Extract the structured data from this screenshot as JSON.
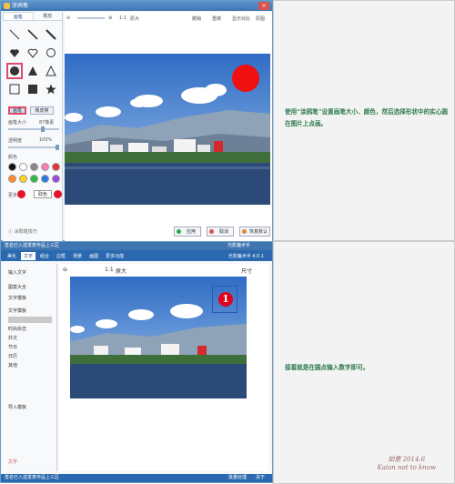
{
  "top_dialog": {
    "title": "涂鸦笔",
    "tab_brush": "画笔",
    "tab_eraser": "橡皮",
    "btn_brush": "画笔",
    "btn_eraser": "橡皮擦",
    "size_label": "画笔大小",
    "size_value": "87像素",
    "opacity_label": "透明度",
    "opacity_value": "100%",
    "color_label": "颜色",
    "more_label": "更多",
    "picker_label": "取色",
    "zoom_value": "1:1",
    "orig_label": "原大",
    "undo_label": "撤销",
    "redo_label": "重做",
    "compare_label": "显示对比",
    "reset_label": "原图",
    "help_label": "涂鸦笔技巧",
    "ok_label": "应用",
    "cancel_label": "取消",
    "default_label": "恢复默认"
  },
  "instruction_1": "使用“涂鸦笔”设置画笔大小、颜色，然后选择形状中的实心圆在图片上点画。",
  "instruction_2": "接着就是在圆点输入数字即可。",
  "bottom_window": {
    "title": "光影魔术手 4.0.1",
    "statusbar_text": "签名已入选发表作品上三区",
    "header_right": "光影魔术手",
    "menu": [
      "美化",
      "文字",
      "组合",
      "边框",
      "场景",
      "画图",
      "更多功能"
    ],
    "menu_active": "文字",
    "left_items": [
      "输入文字",
      "图案大全",
      "文字模板",
      "文字模板",
      "时尚杂志",
      "外文",
      "节日",
      "日历",
      "其他"
    ],
    "left_btn": "导入模板",
    "number_text": "1",
    "zoom_value": "1:1",
    "orig_label": "原大",
    "size_label": "尺寸",
    "statusbar_left": "签名已入选发表作品上三区",
    "statusbar_right_1": "批量处理",
    "statusbar_right_2": "关于",
    "bottom_btn": "文字",
    "bottom_btn2": "保存"
  },
  "signature_line1": "如意 2014.6",
  "signature_line2": "Kaian not to know"
}
